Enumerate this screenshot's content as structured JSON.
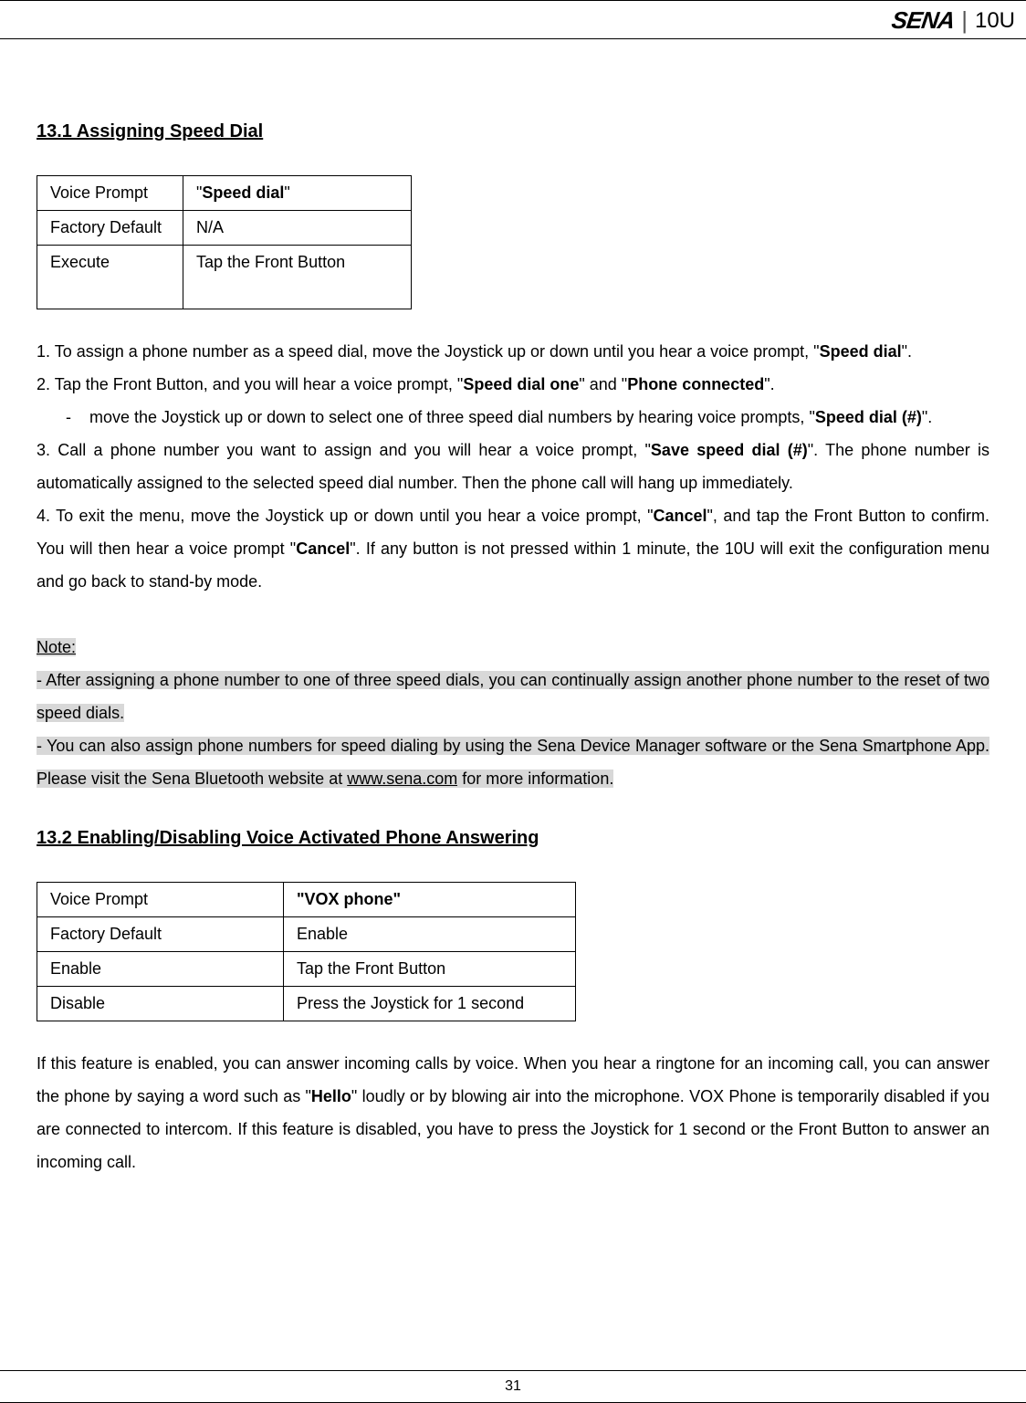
{
  "header": {
    "brand": "SENA",
    "model": "10U"
  },
  "section1": {
    "title": "13.1 Assigning Speed Dial",
    "table": {
      "r1_label": "Voice Prompt",
      "r1_value_prefix": "\"",
      "r1_value_bold": "Speed dial",
      "r1_value_suffix": "\"",
      "r2_label": "Factory Default",
      "r2_value": "N/A",
      "r3_label": "Execute",
      "r3_value": "Tap the Front Button"
    },
    "steps": {
      "s1_pre": "1. To assign a phone number as a speed dial, move the Joystick up or down until you hear a voice prompt, \"",
      "s1_bold": "Speed dial",
      "s1_post": "\".",
      "s2_pre": "2. Tap the Front Button, and you will hear a voice prompt, \"",
      "s2_bold1": "Speed dial one",
      "s2_mid": "\" and \"",
      "s2_bold2": "Phone connected",
      "s2_post": "\".",
      "bullet_dash": "-",
      "bullet_pre": "move the Joystick up or down to select one of three speed dial numbers by hearing voice prompts, \"",
      "bullet_bold": "Speed dial (#)",
      "bullet_post": "\".",
      "s3_pre": "3. Call a phone number you want to assign and you will hear a voice prompt, \"",
      "s3_bold": "Save speed dial (#)",
      "s3_post": "\". The phone number is automatically assigned to the selected speed dial number. Then the phone call will hang up immediately.",
      "s4_pre": "4. To exit the menu, move the Joystick up or down until you hear a voice prompt, \"",
      "s4_bold1": "Cancel",
      "s4_mid1": "\", and tap the Front Button to confirm. You will then hear a voice prompt \"",
      "s4_bold2": "Cancel",
      "s4_post": "\". If any button is not pressed within 1 minute, the 10U will exit the configuration menu and go back to stand-by mode."
    },
    "note": {
      "title": "Note:",
      "line1": "- After assigning a phone number to one of three speed dials, you can continually assign another phone number to the reset of two speed dials.",
      "line2_pre": "- You can also assign phone numbers for speed dialing by using the Sena Device Manager software or the Sena Smartphone App. Please visit the Sena Bluetooth website at ",
      "line2_url": "www.sena.com",
      "line2_post": " for more information."
    }
  },
  "section2": {
    "title": "13.2 Enabling/Disabling Voice Activated Phone Answering",
    "table": {
      "r1_label": "Voice Prompt",
      "r1_value": "\"VOX phone\"",
      "r2_label": "Factory Default",
      "r2_value": "Enable",
      "r3_label": "Enable",
      "r3_value": "Tap the Front Button",
      "r4_label": "Disable",
      "r4_value": "Press the Joystick for 1 second"
    },
    "body_pre": "If this feature is enabled, you can answer incoming calls by voice. When you hear a ringtone for an incoming call, you can answer the phone by saying a word such as \"",
    "body_bold": "Hello",
    "body_post": "\" loudly or by blowing air into the microphone. VOX Phone is temporarily disabled if you are connected to intercom. If this feature is disabled, you have to press the Joystick for 1 second or the Front Button to answer an incoming call."
  },
  "footer": {
    "page": "31"
  }
}
